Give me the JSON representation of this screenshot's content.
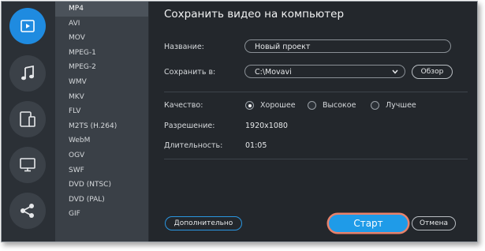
{
  "rail": {
    "items": [
      {
        "icon": "video-icon",
        "active": true
      },
      {
        "icon": "music-note-icon",
        "active": false
      },
      {
        "icon": "devices-icon",
        "active": false
      },
      {
        "icon": "monitor-icon",
        "active": false
      },
      {
        "icon": "share-icon",
        "active": false
      }
    ]
  },
  "formats": [
    "MP4",
    "AVI",
    "MOV",
    "MPEG-1",
    "MPEG-2",
    "WMV",
    "MKV",
    "FLV",
    "M2TS (H.264)",
    "WebM",
    "OGV",
    "SWF",
    "DVD (NTSC)",
    "DVD (PAL)",
    "GIF"
  ],
  "selected_format": "MP4",
  "dialog": {
    "title": "Сохранить видео на компьютер",
    "name_label": "Название:",
    "name_value": "Новый проект",
    "save_to_label": "Сохранить в:",
    "save_to_value": "C:\\Movavi",
    "browse_label": "Обзор",
    "quality_label": "Качество:",
    "quality_options": [
      "Хорошее",
      "Высокое",
      "Лучшее"
    ],
    "quality_selected": "Хорошее",
    "resolution_label": "Разрешение:",
    "resolution_value": "1920x1080",
    "duration_label": "Длительность:",
    "duration_value": "01:05",
    "advanced_label": "Дополнительно",
    "start_label": "Старт",
    "cancel_label": "Отмена"
  },
  "colors": {
    "accent": "#1f9be8",
    "highlight_ring": "#e9826b",
    "background": "#23272c"
  }
}
